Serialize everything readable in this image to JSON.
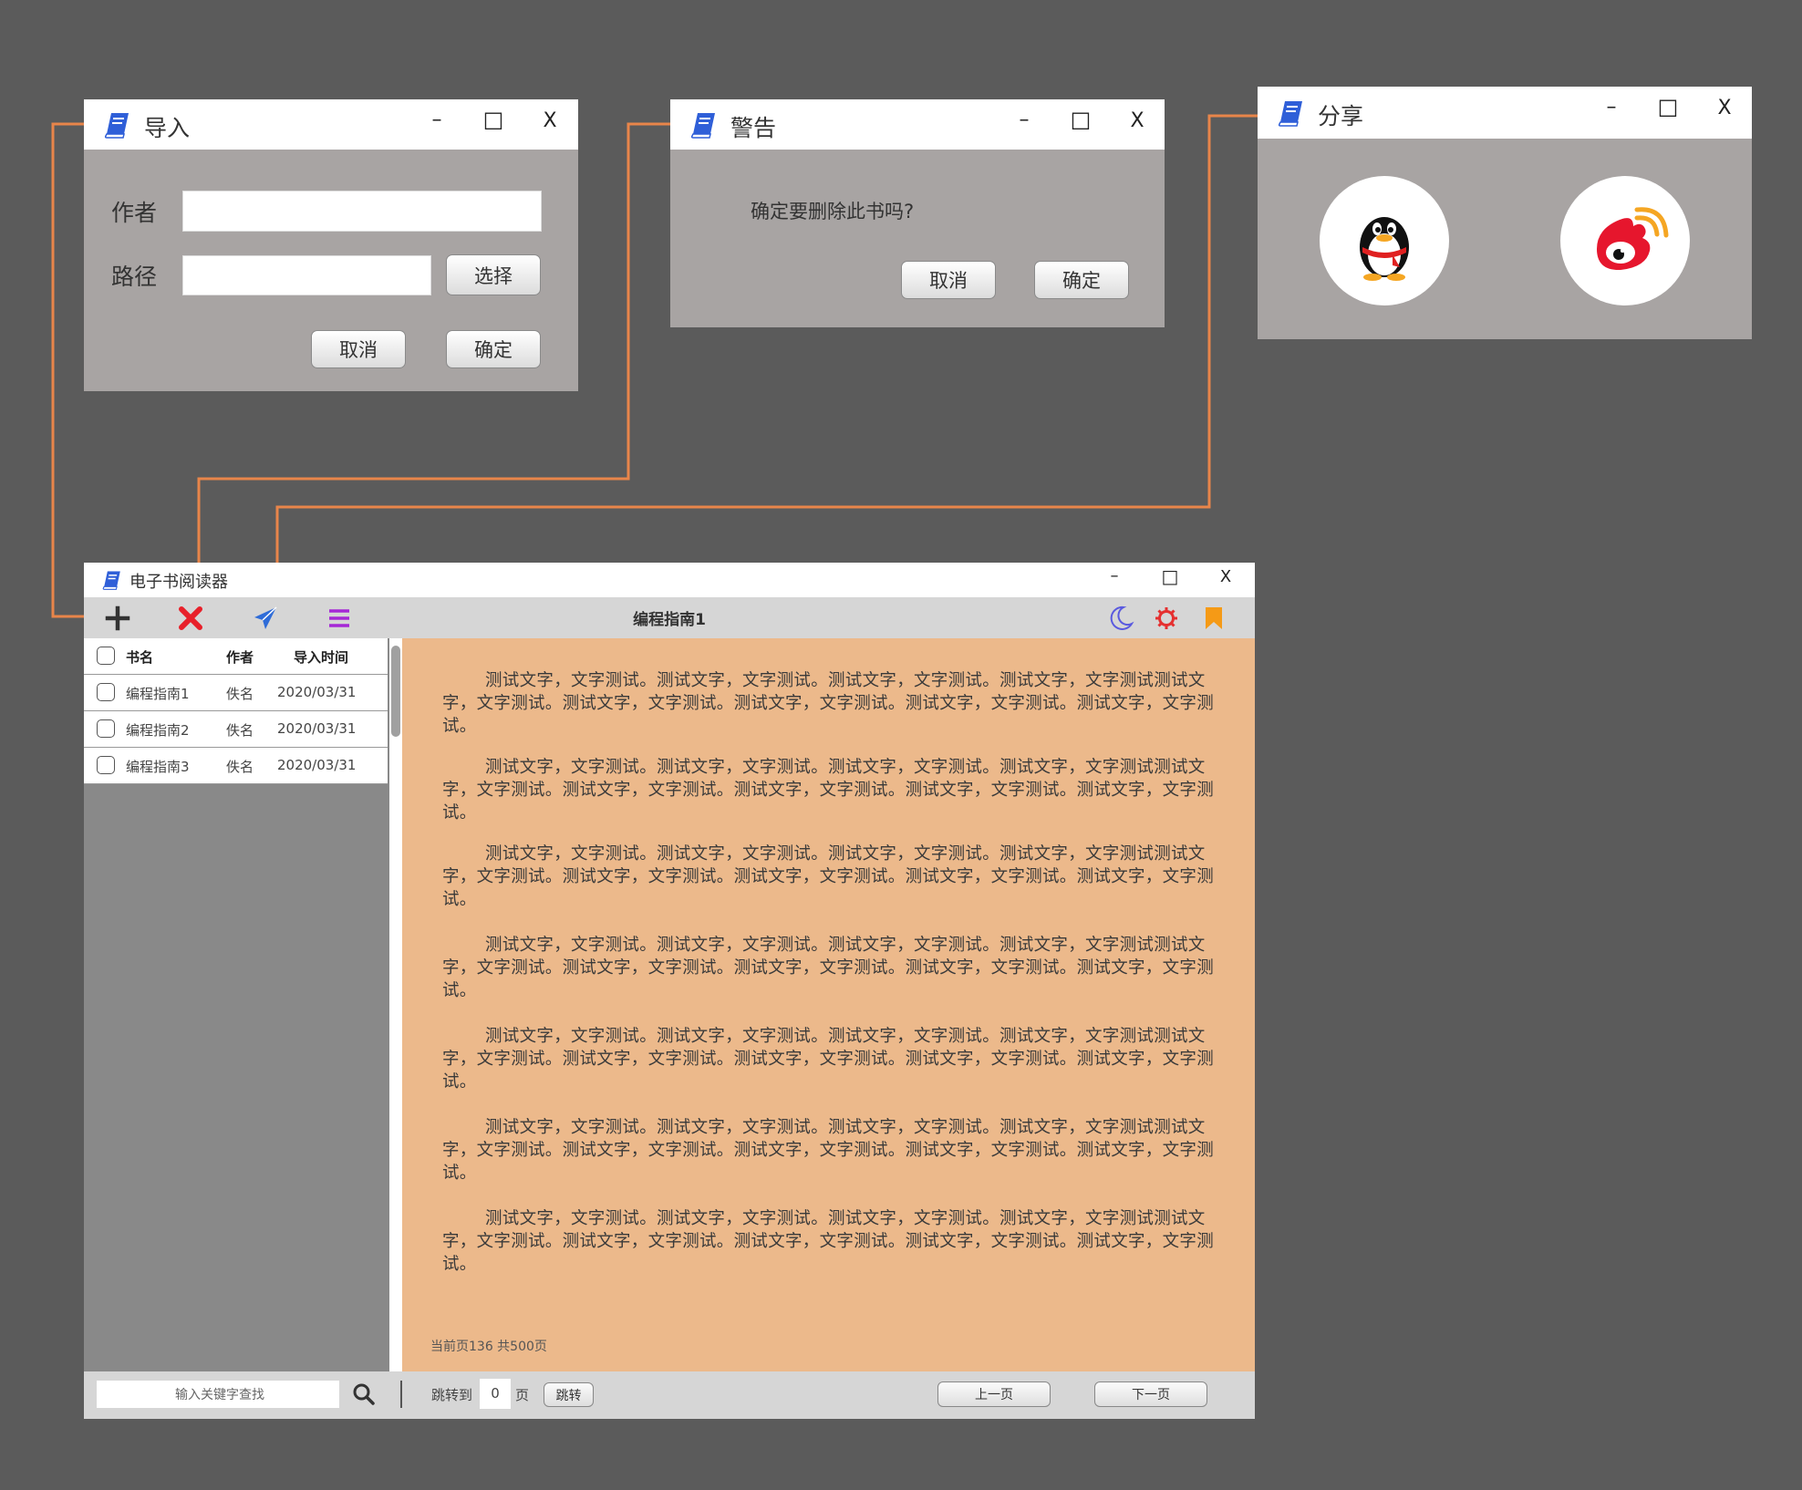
{
  "import_dialog": {
    "title": "导入",
    "author_label": "作者",
    "author_value": "",
    "path_label": "路径",
    "path_value": "",
    "choose_label": "选择",
    "cancel_label": "取消",
    "confirm_label": "确定"
  },
  "warning_dialog": {
    "title": "警告",
    "message": "确定要删除此书吗?",
    "cancel_label": "取消",
    "confirm_label": "确定"
  },
  "share_dialog": {
    "title": "分享",
    "targets": [
      "qq-icon",
      "weibo-icon"
    ]
  },
  "window_controls": {
    "minimize": "–",
    "maximize": "□",
    "close": "X"
  },
  "main": {
    "title": "电子书阅读器",
    "book_title": "编程指南1",
    "toolbar_icons": [
      "plus-icon",
      "delete-icon",
      "send-icon",
      "menu-icon",
      "moon-icon",
      "settings-icon",
      "bookmark-icon"
    ],
    "list": {
      "headers": [
        "书名",
        "作者",
        "导入时间"
      ],
      "rows": [
        {
          "name": "编程指南1",
          "author": "佚名",
          "date": "2020/03/31"
        },
        {
          "name": "编程指南2",
          "author": "佚名",
          "date": "2020/03/31"
        },
        {
          "name": "编程指南3",
          "author": "佚名",
          "date": "2020/03/31"
        }
      ]
    },
    "content": {
      "paragraphs": [
        "测试文字，文字测试。测试文字，文字测试。测试文字，文字测试。测试文字，文字测试测试文字，文字测试。测试文字，文字测试。测试文字，文字测试。测试文字，文字测试。测试文字，文字测试。",
        "测试文字，文字测试。测试文字，文字测试。测试文字，文字测试。测试文字，文字测试测试文字，文字测试。测试文字，文字测试。测试文字，文字测试。测试文字，文字测试。测试文字，文字测试。",
        "测试文字，文字测试。测试文字，文字测试。测试文字，文字测试。测试文字，文字测试测试文字，文字测试。测试文字，文字测试。测试文字，文字测试。测试文字，文字测试。测试文字，文字测试。",
        "测试文字，文字测试。测试文字，文字测试。测试文字，文字测试。测试文字，文字测试测试文字，文字测试。测试文字，文字测试。测试文字，文字测试。测试文字，文字测试。测试文字，文字测试。",
        "测试文字，文字测试。测试文字，文字测试。测试文字，文字测试。测试文字，文字测试测试文字，文字测试。测试文字，文字测试。测试文字，文字测试。测试文字，文字测试。测试文字，文字测试。",
        "测试文字，文字测试。测试文字，文字测试。测试文字，文字测试。测试文字，文字测试测试文字，文字测试。测试文字，文字测试。测试文字，文字测试。测试文字，文字测试。测试文字，文字测试。",
        "测试文字，文字测试。测试文字，文字测试。测试文字，文字测试。测试文字，文字测试测试文字，文字测试。测试文字，文字测试。测试文字，文字测试。测试文字，文字测试。测试文字，文字测试。"
      ],
      "page_info": "当前页136  共500页"
    },
    "bottom": {
      "search_placeholder": "输入关键字查找",
      "jump_label": "跳转到",
      "page_value": "0",
      "page_unit": "页",
      "jump_button": "跳转",
      "prev_button": "上一页",
      "next_button": "下一页"
    }
  },
  "colors": {
    "background": "#5b5b5b",
    "dialog_body": "#a8a4a3",
    "reader_bg": "#ecb98b",
    "connector": "#e8854a",
    "delete": "#e8202a",
    "send": "#2f6cd8",
    "menu": "#a528d6",
    "moon": "#5a5adf",
    "settings": "#e53030",
    "bookmark": "#f59a16",
    "book_icon": "#2f5fd8"
  }
}
